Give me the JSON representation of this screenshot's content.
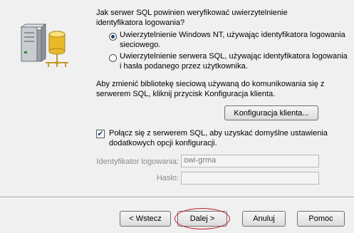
{
  "question": "Jak serwer SQL powinien weryfikować uwierzytelnienie identyfikatora logowania?",
  "auth_options": [
    {
      "label": "Uwierzytelnienie Windows NT, używając identyfikatora logowania sieciowego.",
      "checked": true
    },
    {
      "label": "Uwierzytelnienie serwera SQL, używając identyfikatora logowania i hasła podanego przez użytkownika.",
      "checked": false
    }
  ],
  "client_config": {
    "info": "Aby zmienić bibliotekę sieciową używaną do komunikowania się z serwerem SQL, kliknij przycisk Konfiguracja klienta.",
    "button_label": "Konfiguracja klienta..."
  },
  "connect_option": {
    "label": "Połącz się z serwerem SQL, aby uzyskać domyślne ustawienia dodatkowych opcji konfiguracji.",
    "checked": true
  },
  "login": {
    "label": "Identyfikator logowania:",
    "value": "owi-grma"
  },
  "password": {
    "label": "Hasło:",
    "value": ""
  },
  "buttons": {
    "back": "< Wstecz",
    "next": "Dalej >",
    "cancel": "Anuluj",
    "help": "Pomoc"
  },
  "colors": {
    "background": "#f0f0f0",
    "annotation_circle": "#c0202e"
  },
  "icons": [
    "server-database-icon"
  ]
}
